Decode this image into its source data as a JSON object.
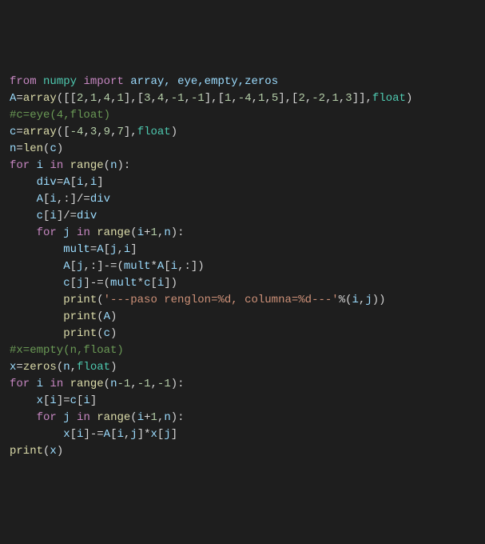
{
  "code": {
    "line1": {
      "from": "from",
      "numpy": "numpy",
      "import": "import",
      "names": " array, eye,empty,zeros"
    },
    "line2": {
      "var": "A",
      "fn": "array",
      "args": "([[",
      "n1": "2",
      "c1": ",",
      "n2": "1",
      "c2": ",",
      "n3": "4",
      "c3": ",",
      "n4": "1",
      "b1": "],[",
      "n5": "3",
      "c4": ",",
      "n6": "4",
      "c5": ",",
      "n7": "-1",
      "c6": ",",
      "n8": "-1",
      "b2": "],[",
      "n9": "1",
      "c7": ",",
      "n10": "-4",
      "c8": ",",
      "n11": "1",
      "c9": ",",
      "n12": "5",
      "b3": "],[",
      "n13": "2",
      "c10": ",",
      "n14": "-2",
      "c11": ",",
      "n15": "1",
      "c12": ",",
      "n16": "3",
      "b4": "]],",
      "type": "float",
      "close": ")"
    },
    "line3": "#c=eye(4,float)",
    "line4": {
      "var": "c",
      "fn": "array",
      "open": "([",
      "n1": "-4",
      "c1": ",",
      "n2": "3",
      "c2": ",",
      "n3": "9",
      "c3": ",",
      "n4": "7",
      "close": "],",
      "type": "float",
      "end": ")"
    },
    "line5": {
      "var": "n",
      "fn": "len",
      "arg": "c"
    },
    "line6": {
      "for": "for",
      "i": "i",
      "in": "in",
      "range": "range",
      "arg": "n"
    },
    "line7": {
      "var": "div",
      "a": "A",
      "i1": "i",
      "i2": "i"
    },
    "line8": {
      "a": "A",
      "i": "i",
      "div": "div"
    },
    "line9": {
      "c": "c",
      "i": "i",
      "div": "div"
    },
    "line10": {
      "for": "for",
      "j": "j",
      "in": "in",
      "range": "range",
      "i": "i",
      "one": "1",
      "n": "n"
    },
    "line11": {
      "mult": "mult",
      "a": "A",
      "j": "j",
      "i": "i"
    },
    "line12": {
      "a": "A",
      "j": "j",
      "mult": "mult",
      "a2": "A",
      "i": "i"
    },
    "line13": {
      "c": "c",
      "j": "j",
      "mult": "mult",
      "c2": "c",
      "i": "i"
    },
    "line14": {
      "print": "print",
      "str": "'---paso renglon=%d, columna=%d---'",
      "i": "i",
      "j": "j"
    },
    "line15": {
      "print": "print",
      "a": "A"
    },
    "line16": {
      "print": "print",
      "c": "c"
    },
    "line17": "#x=empty(n,float)",
    "line18": {
      "x": "x",
      "fn": "zeros",
      "n": "n",
      "type": "float"
    },
    "line19": {
      "for": "for",
      "i": "i",
      "in": "in",
      "range": "range",
      "n": "n",
      "m1": "-1",
      "m2": "-1",
      "m3": "-1"
    },
    "line20": {
      "x": "x",
      "i": "i",
      "c": "c",
      "i2": "i"
    },
    "line21": {
      "for": "for",
      "j": "j",
      "in": "in",
      "range": "range",
      "i": "i",
      "one": "1",
      "n": "n"
    },
    "line22": {
      "x": "x",
      "i": "i",
      "a": "A",
      "i2": "i",
      "j": "j",
      "x2": "x",
      "j2": "j"
    },
    "line23": {
      "print": "print",
      "x": "x"
    }
  }
}
